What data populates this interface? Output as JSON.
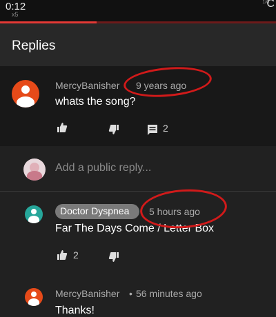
{
  "video": {
    "time": "0:12",
    "speed": "x5",
    "corner_small": "1/0",
    "corner": "C",
    "progress_fraction": 0.35
  },
  "header": {
    "title": "Replies"
  },
  "parent_comment": {
    "author": "MercyBanisher",
    "age": "9 years ago",
    "text": "whats the song?",
    "reply_count": "2",
    "avatar_color": "#e64a19"
  },
  "reply_box": {
    "placeholder": "Add a public reply..."
  },
  "replies": [
    {
      "author": "Doctor Dyspnea",
      "age": "5 hours ago",
      "text": "Far The Days Come / Letter Box",
      "like_count": "2",
      "avatar_color": "#26a69a"
    },
    {
      "author": "MercyBanisher",
      "separator": "•",
      "age": "56 minutes ago",
      "text": "Thanks!",
      "avatar_color": "#e64a19"
    }
  ],
  "annotation": {
    "color": "#d11a1a"
  }
}
